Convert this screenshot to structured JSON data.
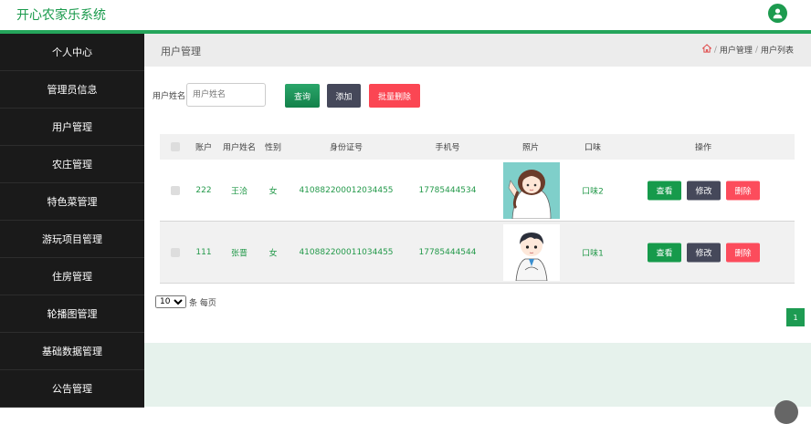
{
  "app": {
    "title": "开心农家乐系统"
  },
  "sidebar": {
    "items": [
      {
        "label": "个人中心"
      },
      {
        "label": "管理员信息"
      },
      {
        "label": "用户管理"
      },
      {
        "label": "农庄管理"
      },
      {
        "label": "特色菜管理"
      },
      {
        "label": "游玩项目管理"
      },
      {
        "label": "住房管理"
      },
      {
        "label": "轮播图管理"
      },
      {
        "label": "基础数据管理"
      },
      {
        "label": "公告管理"
      }
    ]
  },
  "header": {
    "title": "用户管理",
    "breadcrumb": [
      "用户管理",
      "用户列表"
    ]
  },
  "search": {
    "label": "用户姓名",
    "placeholder": "用户姓名",
    "value": "",
    "search_label": "查询",
    "add_label": "添加",
    "batch_delete_label": "批量删除"
  },
  "table": {
    "columns": [
      "账户",
      "用户姓名",
      "性别",
      "身份证号",
      "手机号",
      "照片",
      "口味",
      "操作"
    ],
    "rows": [
      {
        "account": "222",
        "name": "王洽",
        "gender": "女",
        "id_no": "410882200012034455",
        "phone": "17785444534",
        "taste": "口味2",
        "photo": "girl-avatar"
      },
      {
        "account": "111",
        "name": "张晋",
        "gender": "女",
        "id_no": "410882200011034455",
        "phone": "17785444544",
        "taste": "口味1",
        "photo": "boy-avatar"
      }
    ],
    "actions": {
      "view": "查看",
      "edit": "修改",
      "delete": "删除"
    }
  },
  "pagination": {
    "page_size": "10",
    "page_size_suffix": "条 每页",
    "current_page": "1"
  },
  "colors": {
    "brand_green": "#1a9a4c",
    "danger": "#fb4653",
    "dark": "#45485a",
    "sidebar_bg": "#1a1a1a"
  }
}
